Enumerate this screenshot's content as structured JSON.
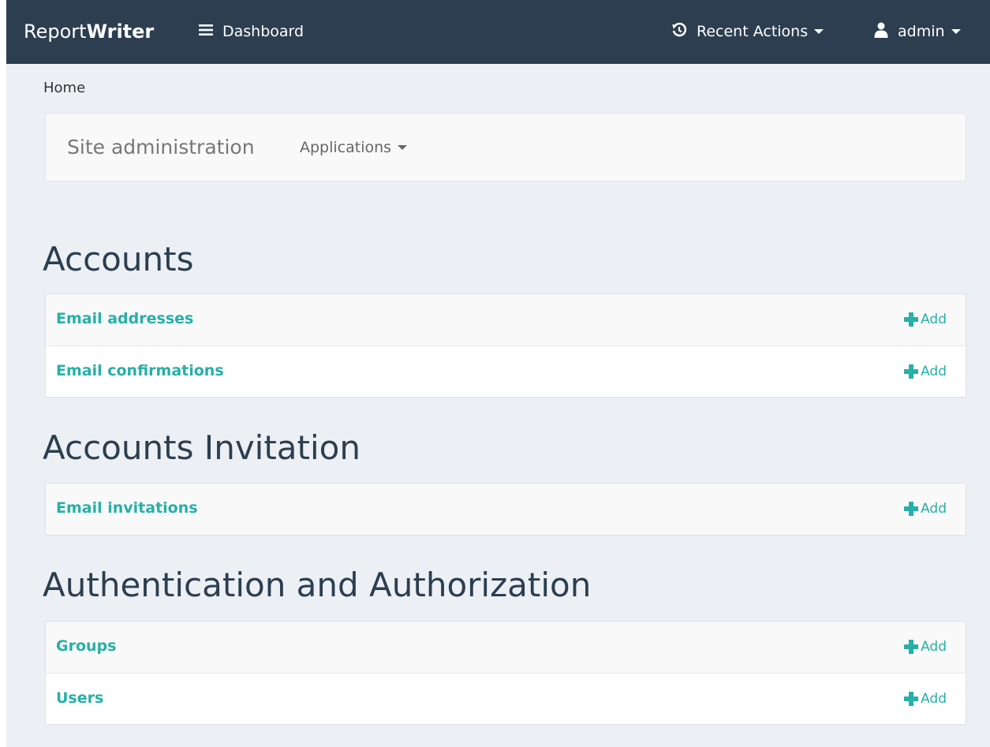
{
  "navbar": {
    "brand_part1": "Report",
    "brand_part2": "Writer",
    "dashboard_label": "Dashboard",
    "dashboard_icon": "hamburger-icon",
    "recent_actions_label": "Recent Actions",
    "recent_actions_icon": "history-icon",
    "user_label": "admin",
    "user_icon": "user-icon"
  },
  "breadcrumb": {
    "home": "Home"
  },
  "subbar": {
    "title": "Site administration",
    "applications_label": "Applications"
  },
  "modules": [
    {
      "title": "Accounts",
      "models": [
        {
          "name": "Email addresses",
          "add_label": "Add"
        },
        {
          "name": "Email confirmations",
          "add_label": "Add"
        }
      ]
    },
    {
      "title": "Accounts Invitation",
      "models": [
        {
          "name": "Email invitations",
          "add_label": "Add"
        }
      ]
    },
    {
      "title": "Authentication and Authorization",
      "models": [
        {
          "name": "Groups",
          "add_label": "Add"
        },
        {
          "name": "Users",
          "add_label": "Add"
        }
      ]
    }
  ],
  "colors": {
    "navbar": "#2c3e50",
    "background": "#ecf0f5",
    "accent": "#26b0a8",
    "heading": "#2c3e50"
  }
}
